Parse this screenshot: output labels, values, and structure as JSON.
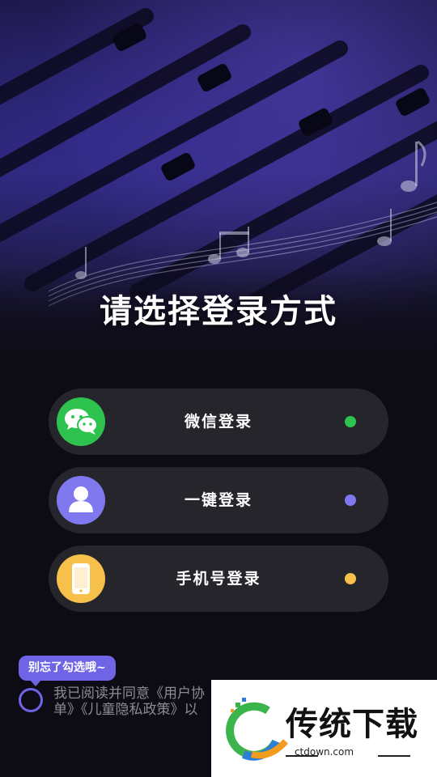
{
  "title": "请选择登录方式",
  "login_options": [
    {
      "label": "微信登录",
      "icon": "wechat-icon",
      "color": "#2ec24f"
    },
    {
      "label": "一键登录",
      "icon": "user-icon",
      "color": "#7f78ee"
    },
    {
      "label": "手机号登录",
      "icon": "phone-icon",
      "color": "#f6c04a"
    }
  ],
  "agreement": {
    "tooltip": "别忘了勾选哦~",
    "text": "我已阅读并同意《用户协议》《隐私政策》《第三方共享清单》《儿童隐私政策》以及",
    "line1": "我已阅读并同意《用户协",
    "line2": "单》《儿童隐私政策》以"
  },
  "watermark": {
    "brand": "传统下载",
    "site": "ctdown.com"
  },
  "colors": {
    "accent": "#6f63e6",
    "button_bg": "#26252c",
    "background": "#0d0c14"
  }
}
